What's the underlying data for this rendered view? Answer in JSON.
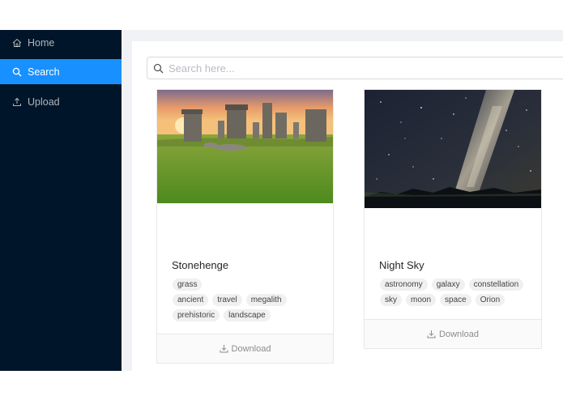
{
  "sidebar": {
    "items": [
      {
        "label": "Home",
        "icon": "home-icon",
        "active": false
      },
      {
        "label": "Search",
        "icon": "search-icon",
        "active": true
      },
      {
        "label": "Upload",
        "icon": "upload-icon",
        "active": false
      }
    ]
  },
  "search": {
    "placeholder": "Search here...",
    "value": ""
  },
  "cards": [
    {
      "title": "Stonehenge",
      "tags": [
        "grass",
        "ancient",
        "travel",
        "megalith",
        "prehistoric",
        "landscape"
      ],
      "download_label": "Download"
    },
    {
      "title": "Night Sky",
      "tags": [
        "astronomy",
        "galaxy",
        "constellation",
        "sky",
        "moon",
        "space",
        "Orion"
      ],
      "download_label": "Download"
    }
  ],
  "colors": {
    "sidebar_bg": "#001529",
    "accent": "#1890ff",
    "page_bg": "#f0f2f5"
  }
}
